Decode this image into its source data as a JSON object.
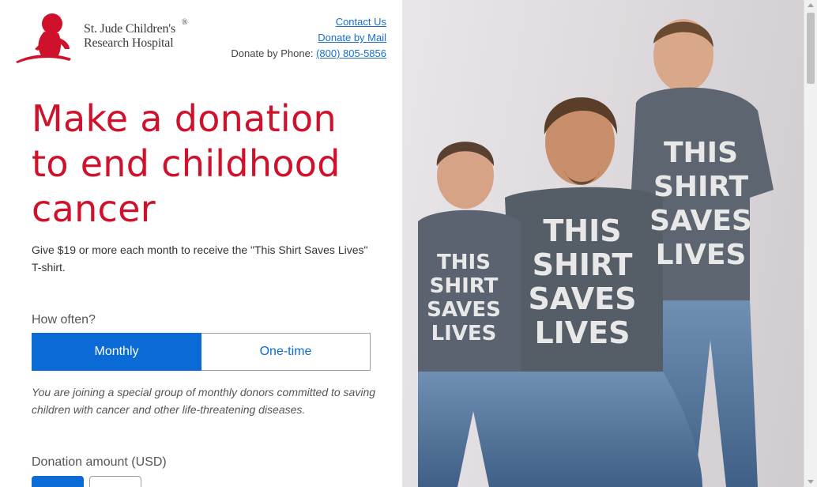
{
  "logo": {
    "line1": "St. Jude Children's",
    "line2": "Research Hospital",
    "registered": "®"
  },
  "header": {
    "contact_us": "Contact Us",
    "donate_by_mail": "Donate by Mail",
    "donate_by_phone_label": "Donate by Phone:",
    "phone_number": "(800) 805-5856"
  },
  "hero": {
    "title": "Make a donation to end childhood cancer",
    "subtitle": "Give $19 or more each month to receive the \"This Shirt Saves Lives\" T-shirt."
  },
  "frequency": {
    "label": "How often?",
    "options": [
      "Monthly",
      "One-time"
    ],
    "selected": "Monthly",
    "note": "You are joining a special group of monthly donors committed to saving children with cancer and other life-threatening diseases."
  },
  "amount": {
    "label": "Donation amount (USD)"
  },
  "photo": {
    "shirt_text": "THIS SHIRT SAVES LIVES"
  },
  "colors": {
    "brand_red": "#d0112b",
    "accent_blue": "#0a6bd6"
  }
}
